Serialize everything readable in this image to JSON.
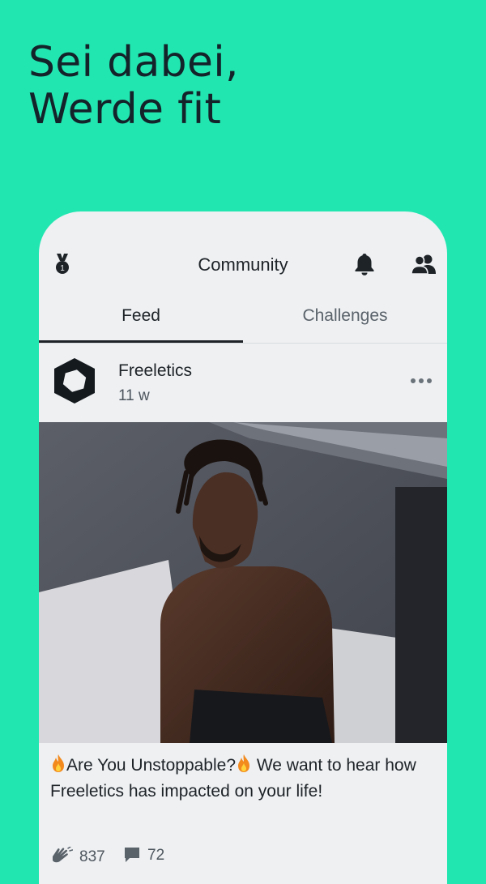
{
  "headline": {
    "line1": "Sei dabei,",
    "line2": "Werde fit"
  },
  "topbar": {
    "title": "Community",
    "icons": [
      "medal-icon",
      "bell-icon",
      "people-icon"
    ]
  },
  "tabs": [
    {
      "label": "Feed",
      "active": true
    },
    {
      "label": "Challenges",
      "active": false
    }
  ],
  "post": {
    "author": "Freeletics",
    "time": "11 w",
    "caption_part1": "Are You Unstoppable?",
    "caption_part2": " We want to hear how Freeletics has impacted on your life!",
    "claps": "837",
    "comments": "72"
  },
  "colors": {
    "background": "#22E6B0",
    "card": "#EEF0F2",
    "text": "#1E2328"
  }
}
